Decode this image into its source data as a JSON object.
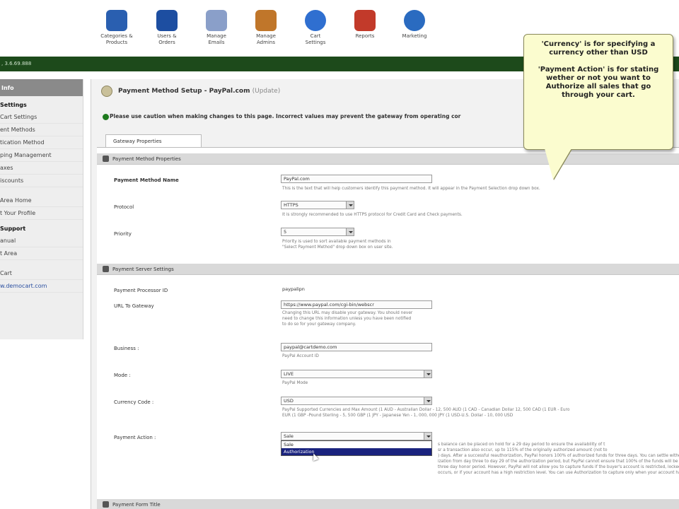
{
  "nav": {
    "items": [
      {
        "label": "Categories &\nProducts",
        "icon": "categories-icon",
        "color": "#2a5fb0"
      },
      {
        "label": "Users &\nOrders",
        "icon": "users-icon",
        "color": "#1d4ea1"
      },
      {
        "label": "Manage\nEmails",
        "icon": "emails-icon",
        "color": "#8a9fc9"
      },
      {
        "label": "Manage\nAdmins",
        "icon": "admins-icon",
        "color": "#c0762a"
      },
      {
        "label": "Cart\nSettings",
        "icon": "settings-icon",
        "color": "#2f6fd0"
      },
      {
        "label": "Reports",
        "icon": "reports-icon",
        "color": "#c23a2a"
      },
      {
        "label": "Marketing",
        "icon": "globe-icon",
        "color": "#2a6bc0"
      }
    ]
  },
  "green_bar": {
    "text": ", 3.6.69.888",
    "color": "#1d4a1b"
  },
  "sidebar": {
    "header": "Info",
    "items": [
      {
        "label": "Settings",
        "bold": true
      },
      {
        "label": "Cart Settings"
      },
      {
        "label": "ent Methods"
      },
      {
        "label": "tication Method"
      },
      {
        "label": "ping Management"
      },
      {
        "label": "axes"
      },
      {
        "label": "iscounts"
      },
      {
        "label": "Area Home"
      },
      {
        "label": "t Your Profile"
      },
      {
        "label": "Support",
        "bold": true
      },
      {
        "label": "anual"
      },
      {
        "label": "t Area"
      },
      {
        "label": "Cart"
      },
      {
        "label": "w.democart.com"
      }
    ]
  },
  "page": {
    "title": "Payment Method Setup - PayPal.com",
    "title_suffix": "(Update)",
    "caution": "Please use caution when making changes to this page. Incorrect values may prevent the gateway from operating cor",
    "tab": "Gateway Properties"
  },
  "sections": {
    "properties": "Payment Method Properties",
    "server": "Payment Server Settings",
    "form": "Payment Form Title"
  },
  "fields": {
    "name": {
      "label": "Payment Method Name",
      "value": "PayPal.com",
      "help": "This is the text that will help customers identify this payment method. It will appear in the Payment Selection drop down box."
    },
    "protocol": {
      "label": "Protocol",
      "value": "HTTPS",
      "help": "It is strongly recommended to use HTTPS protocol for Credit Card and Check payments."
    },
    "priority": {
      "label": "Priority",
      "value": "5",
      "help": "Priority is used to sort available payment methods in\n\"Select Payment Method\" drop down box on user site."
    },
    "processor": {
      "label": "Payment Processor ID",
      "value": "paypalipn"
    },
    "url": {
      "label": "URL To Gateway",
      "value": "https://www.paypal.com/cgi-bin/webscr",
      "help": "Changing this URL may disable your gateway. You should never\nneed to change this information unless you have been notified\nto do so for your gateway company."
    },
    "business": {
      "label": "Business :",
      "value": "paypal@cartdemo.com",
      "help": "PayPal Account ID"
    },
    "mode": {
      "label": "Mode :",
      "value": "LIVE",
      "help": "PayPal Mode"
    },
    "currency": {
      "label": "Currency Code :",
      "value": "USD",
      "help": "PayPal Supported Currencies and Max Amount (1 AUD - Australian Dollar - 12, 500 AUD (1 CAD - Canadian Dollar 12, 500 CAD (1 EUR - Euro\nEUR (1 GBP -Pound Sterling - 5, 500 GBP (1 JPY - Japanese Yen - 1, 000, 000 JPY (1 USD-U.S. Dollar - 10, 000 USD"
    },
    "action": {
      "label": "Payment Action :",
      "value": "Sale",
      "options": [
        "Sale",
        "Authorization"
      ],
      "selected": "Authorization",
      "help": "s balance can be placed on hold for a 29 day period to ensure the availability of t\nsr a transaction also occur, up to 115% of the originally authorized amount (not to\n) days. After a successful reauthorization, PayPal honors 100% of authorized funds for three days. You can settle without\nization from day three to day 29 of the authorization period, but PayPal cannot ensure that 100% of the funds will be availab\nthree day honor period. However, PayPal will not allow you to capture funds if the buyer's account is restricted, locked, or a Payment Rev\noccurs, or if your account has a high restriction level. You can use Authorization to capture only when your account has a low restriction l"
    }
  },
  "callout": {
    "line1": "'Currency' is for specifying a\ncurrency other than USD",
    "line2": "'Payment Action' is for stating\nwether or not you want to\nAuthorize all sales that go\nthrough your cart.",
    "color": "#fbfccf"
  }
}
